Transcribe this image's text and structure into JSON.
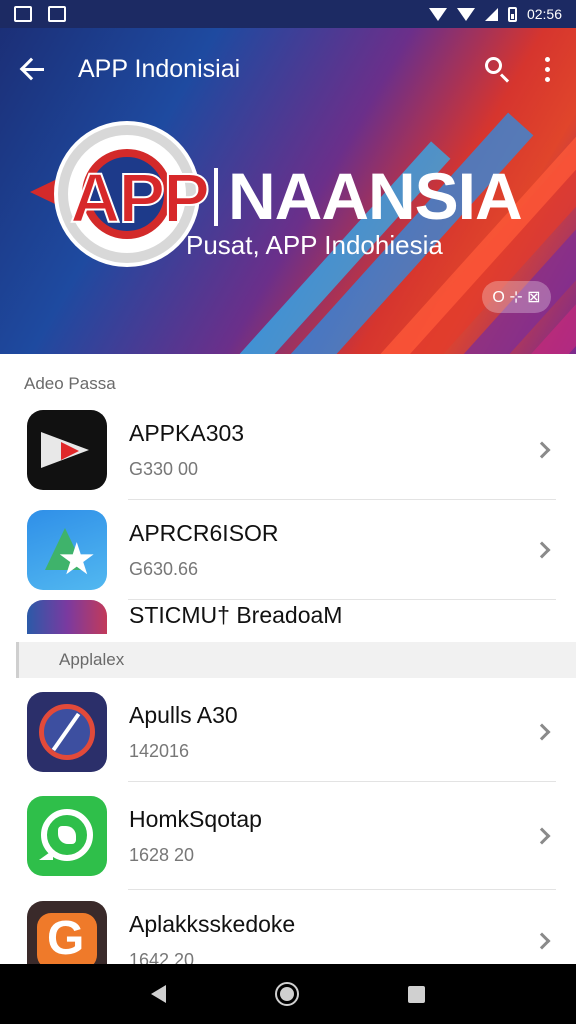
{
  "status_bar": {
    "time": "02:56"
  },
  "app_bar": {
    "title": "APP Indonisiai"
  },
  "hero": {
    "brand_prefix": "APP",
    "brand_name": "NAANSIA",
    "tagline": "Pusat, APP Indohiesia",
    "chip_label": "O ⊹ ⊠"
  },
  "sections": [
    {
      "header": "Adeo Passa",
      "items": [
        {
          "name": "APPKA303",
          "meta": "G330 00",
          "icon": "play-video-icon"
        },
        {
          "name": "APRCR6ISOR",
          "meta": "G630.66",
          "icon": "star-gradient-icon"
        },
        {
          "name": "STICMU† BreadoaM",
          "meta": "",
          "icon": "gradient-app-icon"
        }
      ]
    },
    {
      "header": "Applalex",
      "items": [
        {
          "name": "Apulls A30",
          "meta": "142016",
          "icon": "compass-icon"
        },
        {
          "name": "HomkSqotap",
          "meta": "1628 20",
          "icon": "chat-phone-icon"
        },
        {
          "name": "Aplakksskedoke",
          "meta": "1642 20",
          "icon": "g-badge-icon"
        }
      ]
    }
  ],
  "colors": {
    "header_blue": "#1b2d74",
    "accent_red": "#d7282a",
    "nav_bar": "#000000"
  }
}
